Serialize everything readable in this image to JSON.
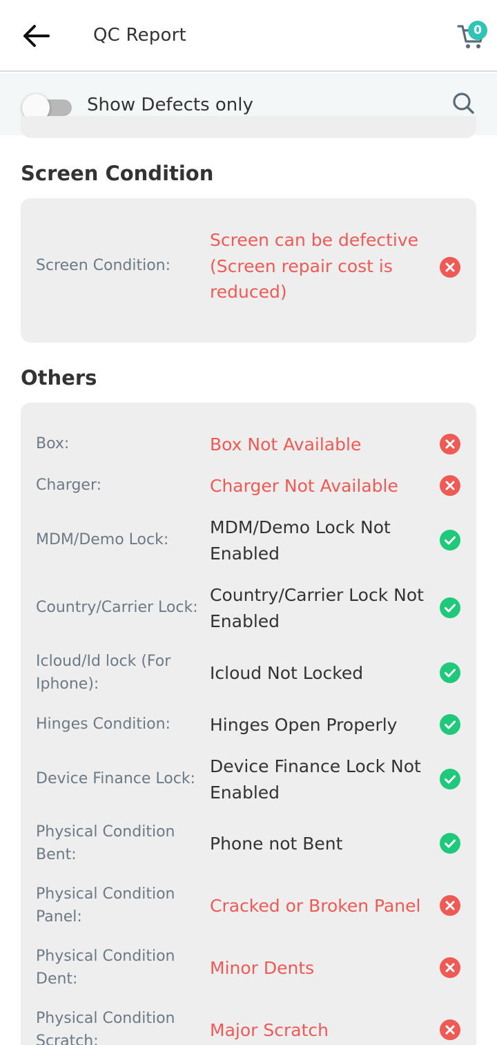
{
  "header": {
    "title": "QC Report",
    "cart_count": "0"
  },
  "filter": {
    "toggle_label": "Show Defects only",
    "toggle_on": false
  },
  "colors": {
    "defect": "#ef5a55",
    "ok": "#1ec97a",
    "badge": "#2ec5b6"
  },
  "sections": [
    {
      "heading": "Screen Condition",
      "rows": [
        {
          "label": "Screen Condition:",
          "value": "Screen can be defective (Screen repair cost is reduced)",
          "status": "defect",
          "icon": "x-circle-icon"
        }
      ]
    },
    {
      "heading": "Others",
      "rows": [
        {
          "label": "Box:",
          "value": "Box Not Available",
          "status": "defect",
          "icon": "x-circle-icon"
        },
        {
          "label": "Charger:",
          "value": "Charger Not Available",
          "status": "defect",
          "icon": "x-circle-icon"
        },
        {
          "label": "MDM/Demo Lock:",
          "value": "MDM/Demo Lock Not Enabled",
          "status": "ok",
          "icon": "check-circle-icon"
        },
        {
          "label": "Country/Carrier Lock:",
          "value": "Country/Carrier Lock Not Enabled",
          "status": "ok",
          "icon": "check-circle-icon"
        },
        {
          "label": "Icloud/Id lock (For Iphone):",
          "value": "Icloud Not Locked",
          "status": "ok",
          "icon": "check-circle-icon"
        },
        {
          "label": "Hinges Condition:",
          "value": "Hinges Open Properly",
          "status": "ok",
          "icon": "check-circle-icon"
        },
        {
          "label": "Device Finance Lock:",
          "value": "Device Finance Lock Not Enabled",
          "status": "ok",
          "icon": "check-circle-icon"
        },
        {
          "label": "Physical Condition Bent:",
          "value": "Phone not Bent",
          "status": "ok",
          "icon": "check-circle-icon"
        },
        {
          "label": "Physical Condition Panel:",
          "value": "Cracked or Broken Panel",
          "status": "defect",
          "icon": "x-circle-icon"
        },
        {
          "label": "Physical Condition Dent:",
          "value": "Minor Dents",
          "status": "defect",
          "icon": "x-circle-icon"
        },
        {
          "label": "Physical Condition Scratch:",
          "value": "Major Scratch",
          "status": "defect",
          "icon": "x-circle-icon"
        }
      ]
    }
  ]
}
